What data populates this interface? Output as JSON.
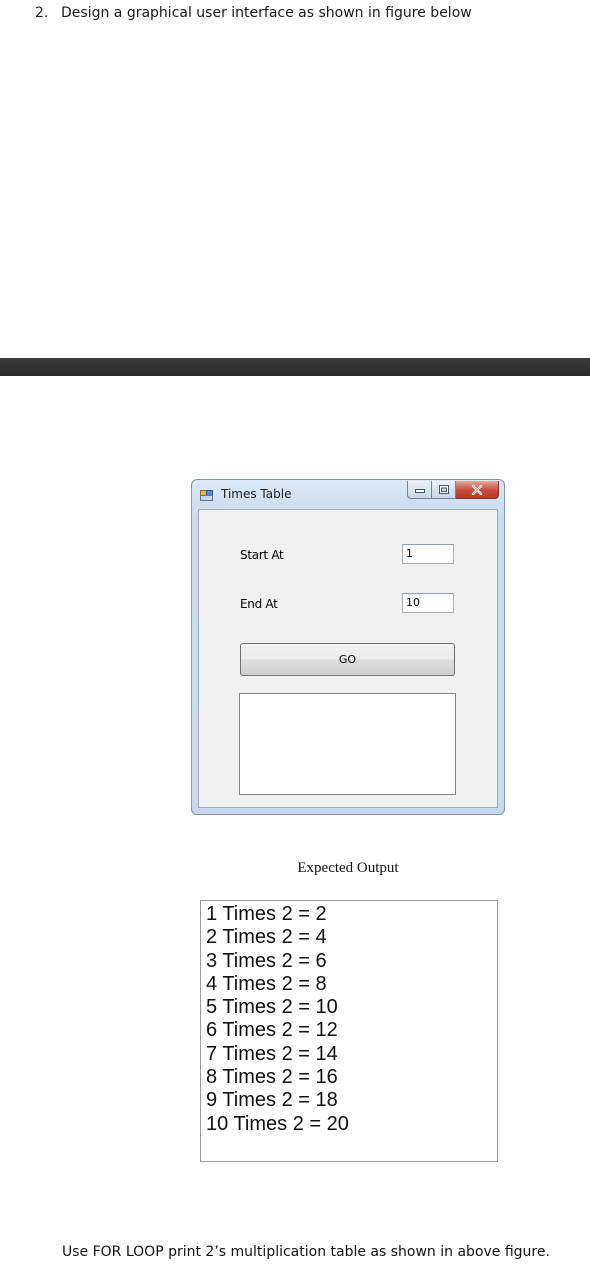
{
  "question": {
    "number": "2.",
    "text": "Design a graphical user interface as shown in figure below"
  },
  "window": {
    "title": "Times Table",
    "icon": "winforms-app-icon",
    "start_label": "Start At",
    "start_value": "1",
    "end_label": "End At",
    "end_value": "10",
    "go_label": "GO",
    "output_text": ""
  },
  "expected_caption": "Expected Output",
  "expected_lines": [
    "1 Times 2 = 2",
    "2 Times 2 = 4",
    "3 Times 2 = 6",
    "4 Times 2 = 8",
    "5 Times 2 = 10",
    "6 Times 2 = 12",
    "7 Times 2 = 14",
    "8 Times 2 = 16",
    "9 Times 2 = 18",
    "10 Times 2 = 20"
  ],
  "footer": "Use FOR LOOP print 2’s multiplication table as shown in above figure.",
  "colors": {
    "close_button": "#c74a3a",
    "title_gradient": "#dbe8f5",
    "client_background": "#f0f0f0"
  }
}
